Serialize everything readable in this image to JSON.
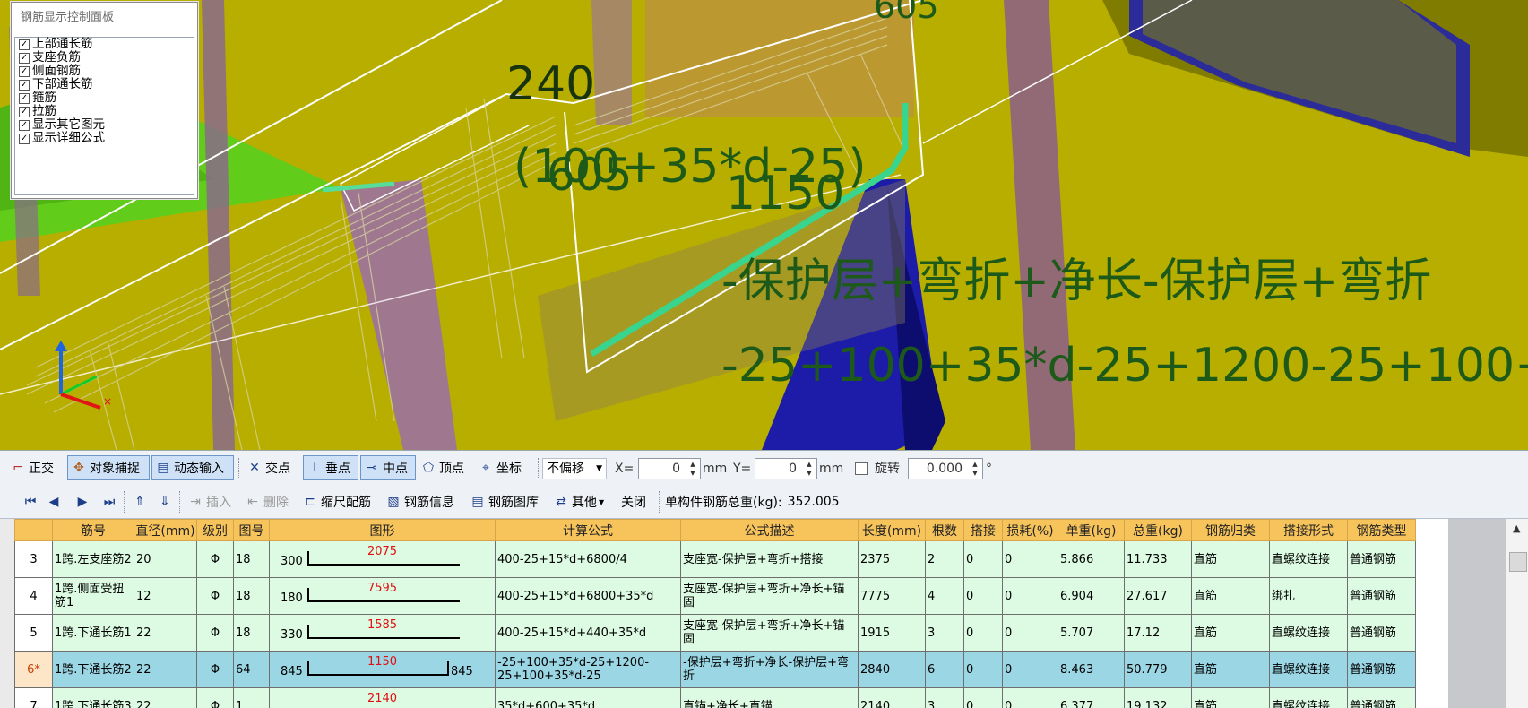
{
  "viewport": {
    "labels": {
      "top_partial": "605",
      "label_240": "240",
      "formula_overlap_a": "(100+35*d-25)",
      "formula_overlap_b": "605",
      "label_1150": "1150",
      "desc_line": "-保护层+弯折+净长-保护层+弯折",
      "formula_line": "-25+100+35*d-25+1200-25+100+3"
    }
  },
  "control_panel": {
    "title": "钢筋显示控制面板",
    "items": [
      {
        "label": "上部通长筋",
        "checked": true
      },
      {
        "label": "支座负筋",
        "checked": true
      },
      {
        "label": "侧面钢筋",
        "checked": true
      },
      {
        "label": "下部通长筋",
        "checked": true
      },
      {
        "label": "箍筋",
        "checked": true
      },
      {
        "label": "拉筋",
        "checked": true
      },
      {
        "label": "显示其它图元",
        "checked": true
      },
      {
        "label": "显示详细公式",
        "checked": true
      }
    ]
  },
  "snap_toolbar": {
    "orthogonal": "正交",
    "object_snap": "对象捕捉",
    "dynamic_input": "动态输入",
    "intersection": "交点",
    "perpendicular": "垂点",
    "midpoint": "中点",
    "vertex": "顶点",
    "coordinate": "坐标",
    "offset_mode": "不偏移",
    "x_label": "X=",
    "x_value": "0",
    "x_unit": "mm",
    "y_label": "Y=",
    "y_value": "0",
    "y_unit": "mm",
    "rotate_label": "旋转",
    "rotate_value": "0.000",
    "rotate_unit": "°"
  },
  "rebar_toolbar": {
    "insert": "插入",
    "delete": "删除",
    "scale_rebar": "缩尺配筋",
    "rebar_info": "钢筋信息",
    "rebar_library": "钢筋图库",
    "other": "其他",
    "close": "关闭",
    "total_weight_label": "单构件钢筋总重(kg):",
    "total_weight_value": "352.005"
  },
  "grid": {
    "columns": [
      "筋号",
      "直径(mm)",
      "级别",
      "图号",
      "图形",
      "计算公式",
      "公式描述",
      "长度(mm)",
      "根数",
      "搭接",
      "损耗(%)",
      "单重(kg)",
      "总重(kg)",
      "钢筋归类",
      "搭接形式",
      "钢筋类型"
    ],
    "rows": [
      {
        "row": "3",
        "name": "1跨.左支座筋2",
        "dia": "20",
        "grade": "Φ",
        "fig": "18",
        "shape": {
          "left": "300",
          "mid": "2075",
          "right": ""
        },
        "formula": "400-25+15*d+6800/4",
        "desc": "支座宽-保护层+弯折+搭接",
        "length": "2375",
        "count": "2",
        "lap": "0",
        "loss": "0",
        "unit_wt": "5.866",
        "total_wt": "11.733",
        "category": "直筋",
        "lap_type": "直螺纹连接",
        "type": "普通钢筋",
        "selected": false
      },
      {
        "row": "4",
        "name": "1跨.侧面受扭筋1",
        "dia": "12",
        "grade": "Φ",
        "fig": "18",
        "shape": {
          "left": "180",
          "mid": "7595",
          "right": ""
        },
        "formula": "400-25+15*d+6800+35*d",
        "desc": "支座宽-保护层+弯折+净长+锚固",
        "length": "7775",
        "count": "4",
        "lap": "0",
        "loss": "0",
        "unit_wt": "6.904",
        "total_wt": "27.617",
        "category": "直筋",
        "lap_type": "绑扎",
        "type": "普通钢筋",
        "selected": false
      },
      {
        "row": "5",
        "name": "1跨.下通长筋1",
        "dia": "22",
        "grade": "Φ",
        "fig": "18",
        "shape": {
          "left": "330",
          "mid": "1585",
          "right": ""
        },
        "formula": "400-25+15*d+440+35*d",
        "desc": "支座宽-保护层+弯折+净长+锚固",
        "length": "1915",
        "count": "3",
        "lap": "0",
        "loss": "0",
        "unit_wt": "5.707",
        "total_wt": "17.12",
        "category": "直筋",
        "lap_type": "直螺纹连接",
        "type": "普通钢筋",
        "selected": false
      },
      {
        "row": "6*",
        "name": "1跨.下通长筋2",
        "dia": "22",
        "grade": "Φ",
        "fig": "64",
        "shape": {
          "left": "845",
          "mid": "1150",
          "right": "845"
        },
        "formula": "-25+100+35*d-25+1200-25+100+35*d-25",
        "desc": "-保护层+弯折+净长-保护层+弯折",
        "length": "2840",
        "count": "6",
        "lap": "0",
        "loss": "0",
        "unit_wt": "8.463",
        "total_wt": "50.779",
        "category": "直筋",
        "lap_type": "直螺纹连接",
        "type": "普通钢筋",
        "selected": true
      },
      {
        "row": "7",
        "name": "1跨.下通长筋3",
        "dia": "22",
        "grade": "Φ",
        "fig": "1",
        "shape": {
          "left": "",
          "mid": "2140",
          "right": ""
        },
        "formula": "35*d+600+35*d",
        "desc": "直锚+净长+直锚",
        "length": "2140",
        "count": "3",
        "lap": "0",
        "loss": "0",
        "unit_wt": "6.377",
        "total_wt": "19.132",
        "category": "直筋",
        "lap_type": "直螺纹连接",
        "type": "普通钢筋",
        "selected": false
      }
    ]
  },
  "colors": {
    "viewport_bg": "#b9b100",
    "grid_header": "#f7c45c",
    "grid_row": "#dcfbe2",
    "grid_selected": "#9bd6e4",
    "annotation_text": "#1d5a19",
    "shape_dim_red": "#e01010"
  }
}
